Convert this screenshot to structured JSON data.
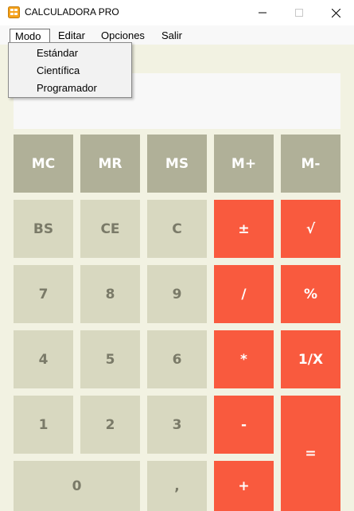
{
  "window": {
    "title": "CALCULADORA PRO",
    "icon": "calculator-app-icon",
    "controls": [
      "minimize-icon",
      "maximize-icon",
      "close-icon"
    ]
  },
  "menubar": {
    "items": [
      "Modo",
      "Editar",
      "Opciones",
      "Salir"
    ]
  },
  "menu_modo": {
    "items": [
      "Estándar",
      "Científica",
      "Programador"
    ]
  },
  "display": {
    "value": ""
  },
  "buttons": {
    "memory": [
      "MC",
      "MR",
      "MS",
      "M+",
      "M-"
    ],
    "row1": [
      "BS",
      "CE",
      "C",
      "±",
      "√"
    ],
    "row2": [
      "7",
      "8",
      "9",
      "/",
      "%"
    ],
    "row3": [
      "4",
      "5",
      "6",
      "*",
      "1/X"
    ],
    "row4": [
      "1",
      "2",
      "3",
      "-",
      "="
    ],
    "row5": [
      "0",
      ",",
      "+"
    ]
  },
  "colors": {
    "background": "#f2f2e2",
    "memory": "#b0b098",
    "number": "#d8d8c0",
    "operator": "#f95a3e",
    "display": "#f8f8f8"
  }
}
